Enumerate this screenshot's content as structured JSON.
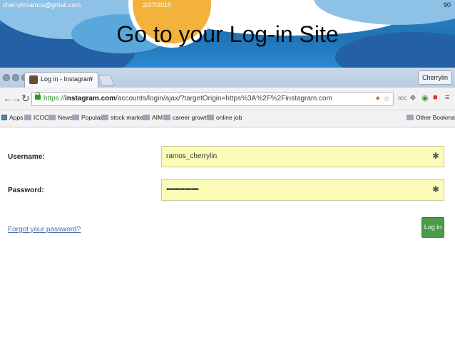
{
  "slide": {
    "email": "cherrylinramos@gmail.com",
    "date": "2/27/2015",
    "page_number": "90",
    "title": "Go to your Log-in Site"
  },
  "browser": {
    "tab_title": "Log in - Instagram",
    "tab_close": "×",
    "profile_name": "Cherrylin",
    "url_scheme": "https://",
    "url_host": "instagram.com",
    "url_path": "/accounts/login/ajax/?targetOrigin=https%3A%2F%2Finstagram.com",
    "bookmarks": [
      {
        "label": "Apps",
        "icon": "apps-icon"
      },
      {
        "label": "ICOC",
        "icon": "folder-icon"
      },
      {
        "label": "News",
        "icon": "folder-icon"
      },
      {
        "label": "Popular",
        "icon": "folder-icon"
      },
      {
        "label": "stock market",
        "icon": "folder-icon"
      },
      {
        "label": "AIM",
        "icon": "folder-icon"
      },
      {
        "label": "career growth",
        "icon": "folder-icon"
      },
      {
        "label": "online job",
        "icon": "folder-icon"
      }
    ],
    "other_bookmarks": "Other Bookmarks"
  },
  "login_form": {
    "username_label": "Username:",
    "username_value": "ramos_cherrylin",
    "password_label": "Password:",
    "password_value": "••••••••••••••••••",
    "forgot_link": "Forgot your password?",
    "login_button": "Log in",
    "button_color": "#4a9a4a",
    "autofill_color": "#fafcb8"
  }
}
